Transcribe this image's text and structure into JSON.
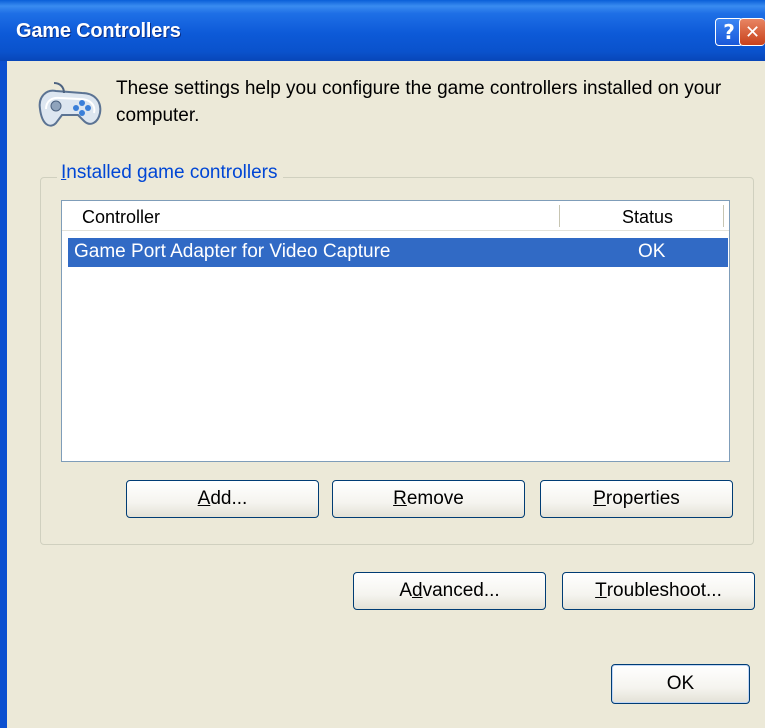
{
  "window": {
    "title": "Game Controllers",
    "help_glyph": "?",
    "close_glyph": "✕"
  },
  "header": {
    "icon": "gamepad-icon",
    "description": "These settings help you configure the game controllers installed on your computer."
  },
  "group": {
    "legend_first": "I",
    "legend_rest": "nstalled game controllers"
  },
  "list": {
    "columns": [
      "Controller",
      "Status"
    ],
    "rows": [
      {
        "controller": "Game Port Adapter for Video Capture",
        "status": "OK",
        "selected": true
      }
    ]
  },
  "buttons": {
    "add_u": "A",
    "add_rest": "dd...",
    "remove_u": "R",
    "remove_rest": "emove",
    "properties_u": "P",
    "properties_rest": "roperties",
    "advanced_pre": "A",
    "advanced_u": "d",
    "advanced_rest": "vanced...",
    "troubleshoot_u": "T",
    "troubleshoot_rest": "roubleshoot...",
    "ok": "OK"
  },
  "colors": {
    "titlebar": "#0A52CC",
    "selection": "#316AC5",
    "legend": "#0046D5",
    "dialog_bg": "#ECE9D8"
  }
}
